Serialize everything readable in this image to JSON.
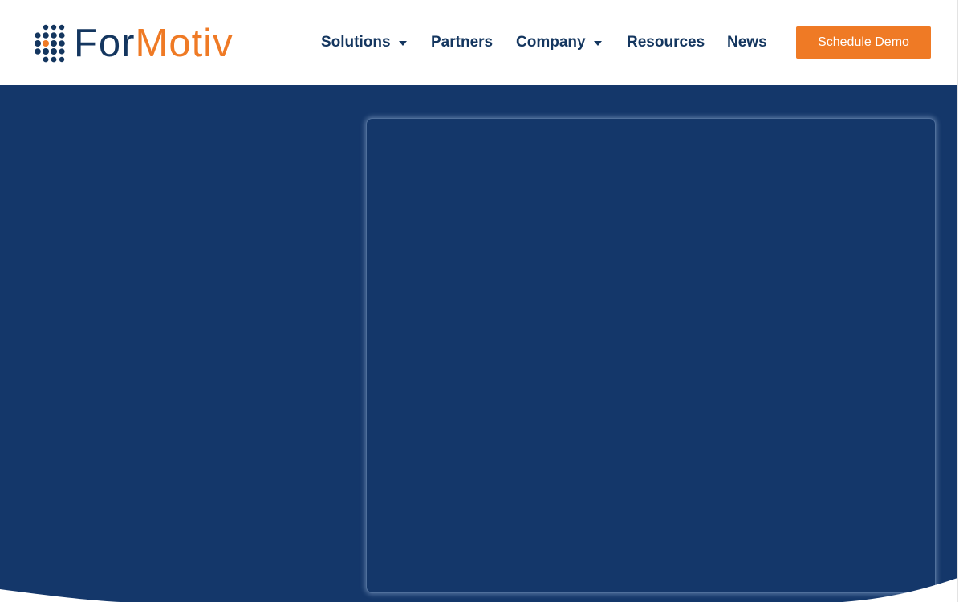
{
  "brand": {
    "name_part1": "For",
    "name_part2": "Motiv",
    "primary_color": "#14365f",
    "accent_color": "#ef7a25",
    "hero_color": "#14376a"
  },
  "nav": {
    "items": [
      {
        "label": "Solutions",
        "has_dropdown": true
      },
      {
        "label": "Partners",
        "has_dropdown": false
      },
      {
        "label": "Company",
        "has_dropdown": true
      },
      {
        "label": "Resources",
        "has_dropdown": false
      },
      {
        "label": "News",
        "has_dropdown": false
      }
    ],
    "cta_label": "Schedule Demo"
  }
}
